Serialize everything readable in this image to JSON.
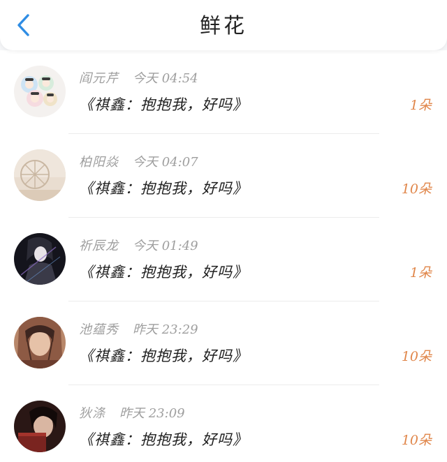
{
  "header": {
    "title": "鲜花",
    "back_icon": "chevron-left-icon"
  },
  "colors": {
    "accent_blue": "#2f8de4",
    "amount_orange": "#e0864a",
    "meta_gray": "#9e9e9e",
    "text_dark": "#1f1f1f"
  },
  "items": [
    {
      "name": "阎元芹",
      "time": "今天 04:54",
      "message": "《祺鑫：抱抱我，好吗》",
      "amount": "1朵"
    },
    {
      "name": "柏阳焱",
      "time": "今天 04:07",
      "message": "《祺鑫：抱抱我，好吗》",
      "amount": "10朵"
    },
    {
      "name": "祈辰龙",
      "time": "今天 01:49",
      "message": "《祺鑫：抱抱我，好吗》",
      "amount": "1朵"
    },
    {
      "name": "池蕴秀",
      "time": "昨天 23:29",
      "message": "《祺鑫：抱抱我，好吗》",
      "amount": "10朵"
    },
    {
      "name": "狄涤",
      "time": "昨天 23:09",
      "message": "《祺鑫：抱抱我，好吗》",
      "amount": "10朵"
    }
  ]
}
